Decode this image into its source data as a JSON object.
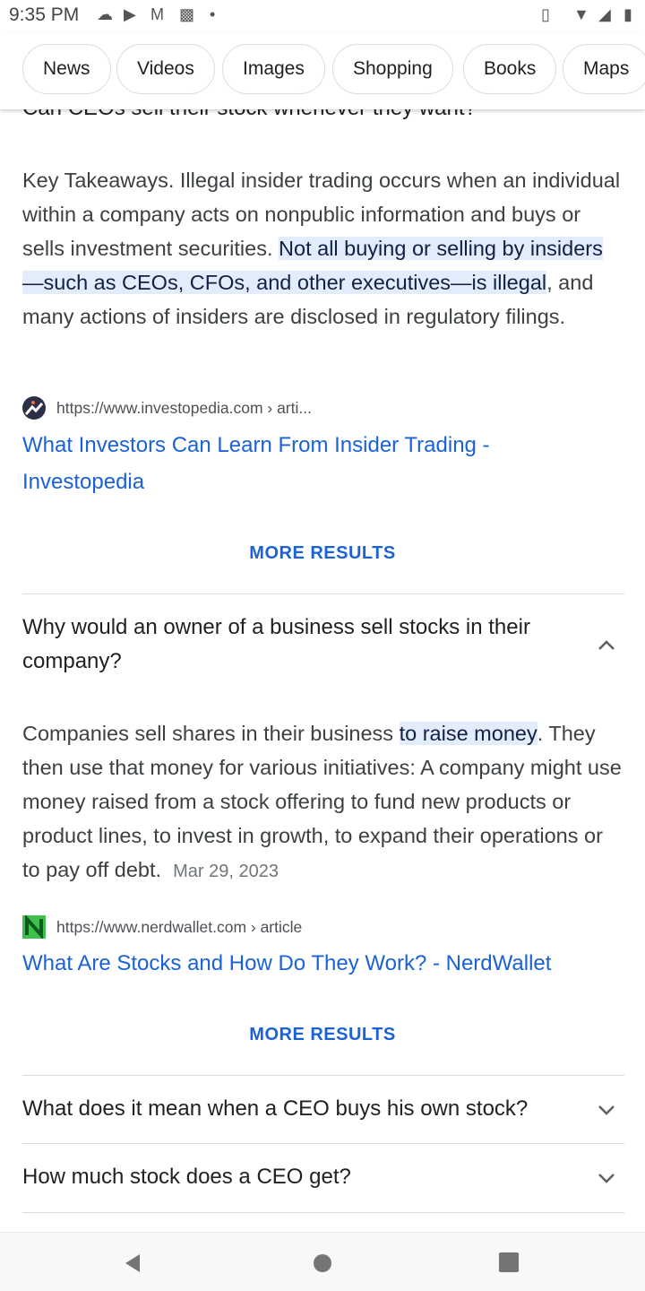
{
  "status_bar": {
    "time": "9:35 PM",
    "icons": [
      "messages-icon",
      "youtube-icon",
      "gmail-icon",
      "photos-icon",
      "dot-icon",
      "vibrate-icon",
      "wifi-icon",
      "signal-icon",
      "battery-icon"
    ]
  },
  "chips": [
    "News",
    "Videos",
    "Images",
    "Shopping",
    "Books",
    "Maps"
  ],
  "faq": [
    {
      "question": "Can CEOs sell their stock whenever they want?",
      "expanded": true,
      "answer_pre": "Key Takeaways. Illegal insider trading occurs when an individual within a company acts on nonpublic information and buys or sells investment securities. ",
      "answer_highlight": "Not all buying or selling by insiders—such as CEOs, CFOs, and other executives—is illegal",
      "answer_post": ", and many actions of insiders are disclosed in regulatory filings.",
      "source_url": "https://www.investopedia.com › arti...",
      "title": "What Investors Can Learn From Insider Trading - Investopedia",
      "more": "MORE RESULTS"
    },
    {
      "question": "Why would an owner of a business sell stocks in their company?",
      "expanded": true,
      "answer_pre": "Companies sell shares in their business ",
      "answer_highlight": "to raise money",
      "answer_post": ". They then use that money for various initiatives: A company might use money raised from a stock offering to fund new products or product lines, to invest in growth, to expand their operations or to pay off debt.",
      "date": "Mar 29, 2023",
      "source_url": "https://www.nerdwallet.com › article",
      "title": "What Are Stocks and How Do They Work? - NerdWallet",
      "more": "MORE RESULTS"
    },
    {
      "question": "What does it mean when a CEO buys his own stock?",
      "expanded": false
    },
    {
      "question": "How much stock does a CEO get?",
      "expanded": false
    }
  ],
  "colors": {
    "link": "#1a62d6",
    "highlight": "#e8f0fe"
  }
}
